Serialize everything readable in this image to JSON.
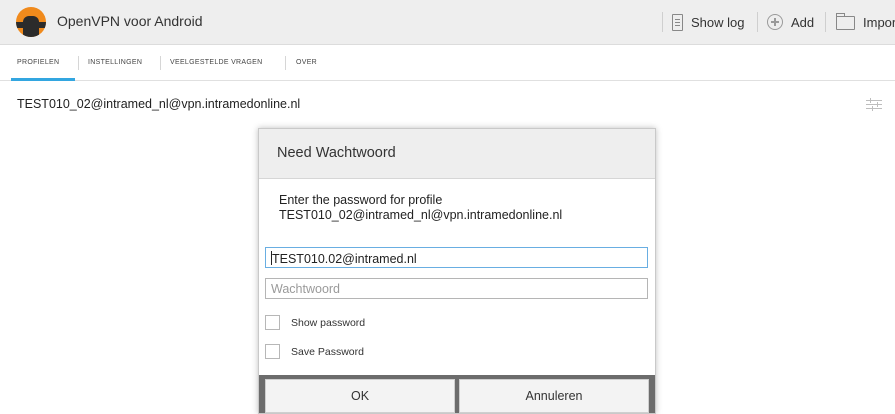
{
  "app": {
    "title": "OpenVPN voor Android"
  },
  "actions": {
    "show_log": "Show log",
    "add": "Add",
    "import": "Import"
  },
  "tabs": [
    {
      "label": "PROFIELEN",
      "selected": true
    },
    {
      "label": "INSTELLINGEN",
      "selected": false
    },
    {
      "label": "VEELGESTELDE VRAGEN",
      "selected": false
    },
    {
      "label": "OVER",
      "selected": false
    }
  ],
  "profile": {
    "name": "TEST010_02@intramed_nl@vpn.intramedonline.nl"
  },
  "dialog": {
    "title": "Need Wachtwoord",
    "message_line1": "Enter the password for profile",
    "message_line2": "TEST010_02@intramed_nl@vpn.intramedonline.nl",
    "username_value": "TEST010.02@intramed.nl",
    "password_placeholder": "Wachtwoord",
    "show_password_label": "Show password",
    "show_password_checked": false,
    "save_password_label": "Save Password",
    "save_password_checked": false,
    "ok_label": "OK",
    "cancel_label": "Annuleren"
  },
  "colors": {
    "accent": "#33a6e0",
    "app_icon": "#f08a1c",
    "button_bar": "#6c6c6c"
  },
  "icons": {
    "app": "openvpn-app-icon",
    "log": "log-icon",
    "add": "add-icon",
    "import": "folder-icon",
    "settings": "settings-sliders-icon"
  }
}
